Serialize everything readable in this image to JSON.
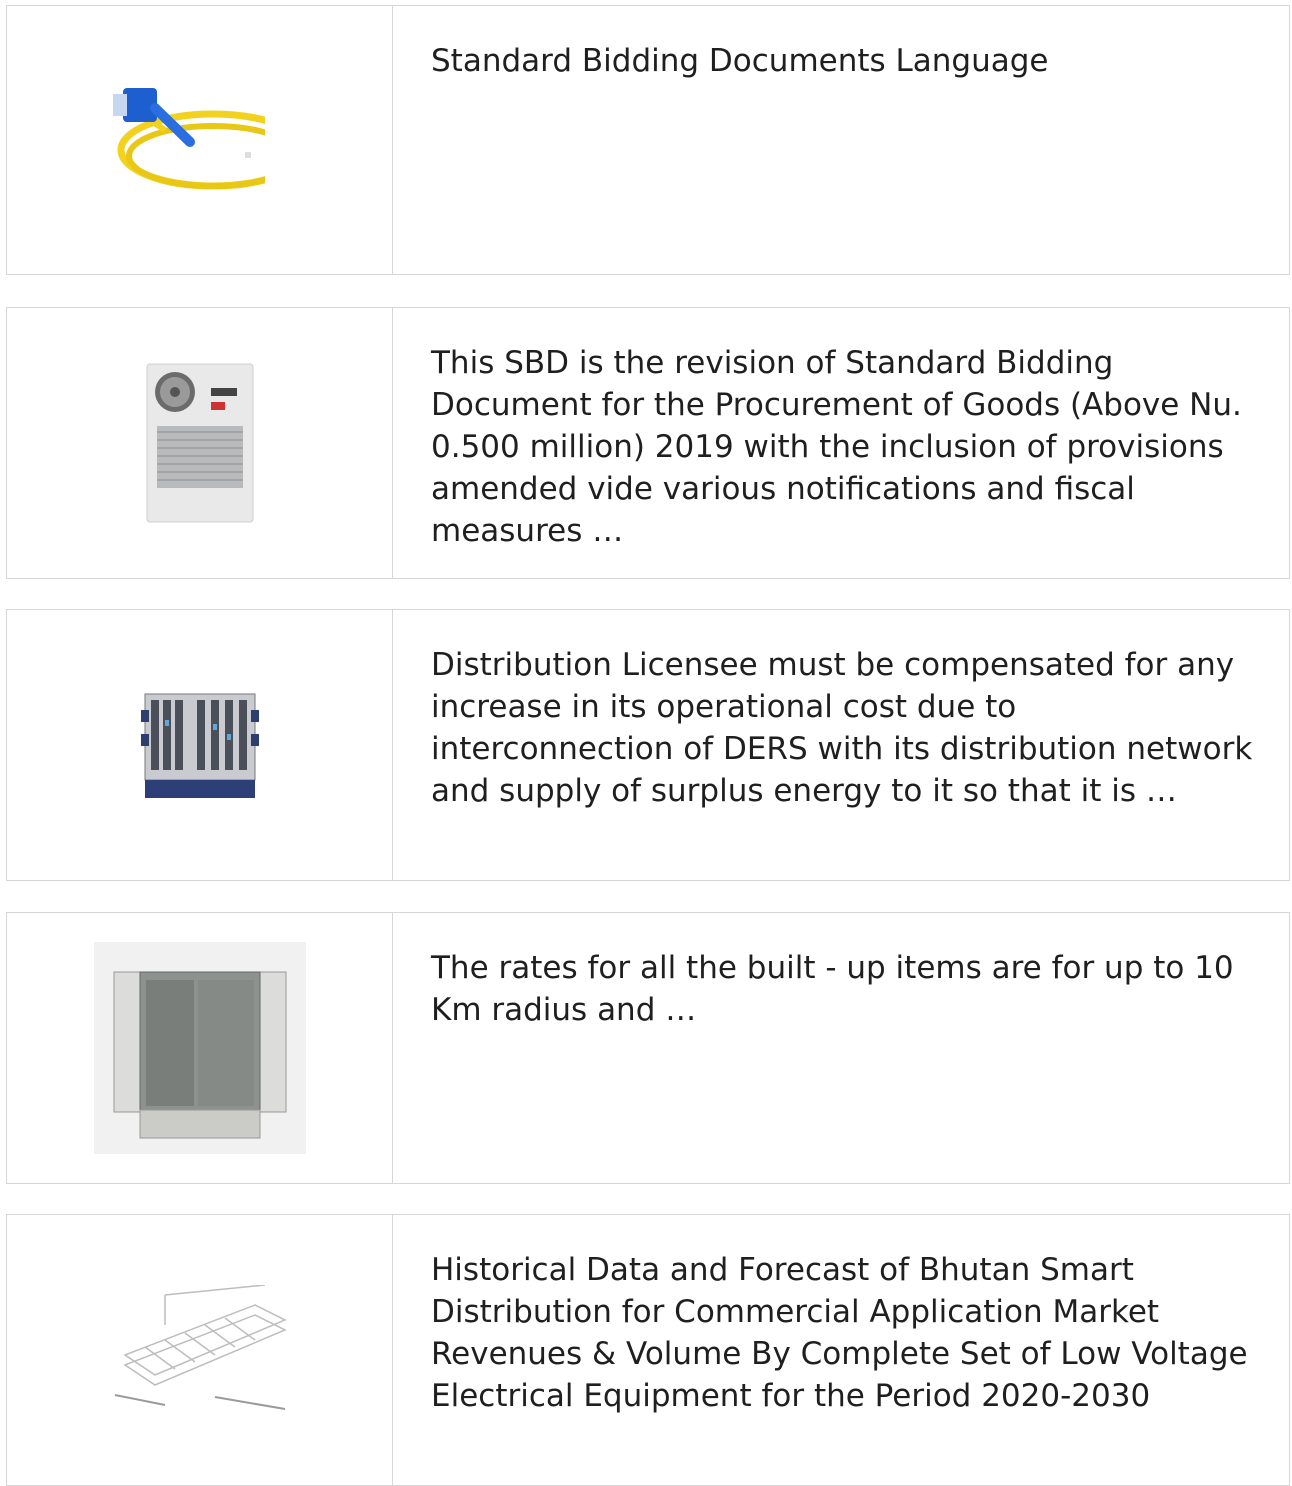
{
  "results": [
    {
      "image": "fiber-patch-cable-image",
      "text": "Standard Bidding Documents Language"
    },
    {
      "image": "cabinet-air-conditioner-image",
      "text": "This SBD is the revision of Standard Bidding Document for the Procurement of Goods (Above Nu. 0.500 million) 2019 with the inclusion of provisions amended vide various notifications and fiscal measures …"
    },
    {
      "image": "telecom-chassis-image",
      "text": "Distribution Licensee must be compensated for any increase in its operational cost due to interconnection of DERS with its distribution network and supply of surplus energy to it so that it is …"
    },
    {
      "image": "outdoor-cabinet-image",
      "text": "The rates for all the built - up items are for up to 10 Km radius and …"
    },
    {
      "image": "wire-cable-tray-image",
      "text": "Historical Data and Forecast of Bhutan Smart Distribution for Commercial Application Market Revenues & Volume By Complete Set of Low Voltage Electrical Equipment for the Period 2020-2030"
    }
  ]
}
